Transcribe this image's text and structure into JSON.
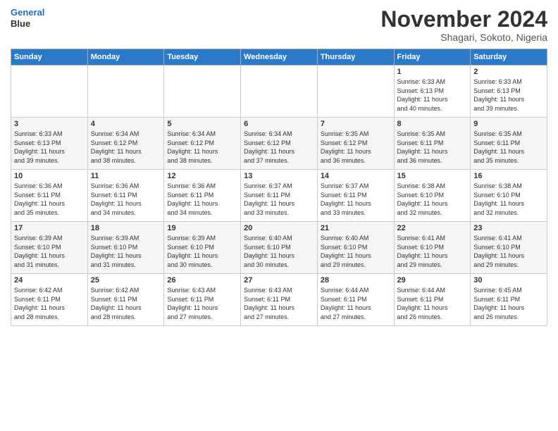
{
  "logo": {
    "line1": "General",
    "line2": "Blue"
  },
  "title": "November 2024",
  "subtitle": "Shagari, Sokoto, Nigeria",
  "days_of_week": [
    "Sunday",
    "Monday",
    "Tuesday",
    "Wednesday",
    "Thursday",
    "Friday",
    "Saturday"
  ],
  "weeks": [
    [
      {
        "day": "",
        "info": ""
      },
      {
        "day": "",
        "info": ""
      },
      {
        "day": "",
        "info": ""
      },
      {
        "day": "",
        "info": ""
      },
      {
        "day": "",
        "info": ""
      },
      {
        "day": "1",
        "info": "Sunrise: 6:33 AM\nSunset: 6:13 PM\nDaylight: 11 hours\nand 40 minutes."
      },
      {
        "day": "2",
        "info": "Sunrise: 6:33 AM\nSunset: 6:13 PM\nDaylight: 11 hours\nand 39 minutes."
      }
    ],
    [
      {
        "day": "3",
        "info": "Sunrise: 6:33 AM\nSunset: 6:13 PM\nDaylight: 11 hours\nand 39 minutes."
      },
      {
        "day": "4",
        "info": "Sunrise: 6:34 AM\nSunset: 6:12 PM\nDaylight: 11 hours\nand 38 minutes."
      },
      {
        "day": "5",
        "info": "Sunrise: 6:34 AM\nSunset: 6:12 PM\nDaylight: 11 hours\nand 38 minutes."
      },
      {
        "day": "6",
        "info": "Sunrise: 6:34 AM\nSunset: 6:12 PM\nDaylight: 11 hours\nand 37 minutes."
      },
      {
        "day": "7",
        "info": "Sunrise: 6:35 AM\nSunset: 6:12 PM\nDaylight: 11 hours\nand 36 minutes."
      },
      {
        "day": "8",
        "info": "Sunrise: 6:35 AM\nSunset: 6:11 PM\nDaylight: 11 hours\nand 36 minutes."
      },
      {
        "day": "9",
        "info": "Sunrise: 6:35 AM\nSunset: 6:11 PM\nDaylight: 11 hours\nand 35 minutes."
      }
    ],
    [
      {
        "day": "10",
        "info": "Sunrise: 6:36 AM\nSunset: 6:11 PM\nDaylight: 11 hours\nand 35 minutes."
      },
      {
        "day": "11",
        "info": "Sunrise: 6:36 AM\nSunset: 6:11 PM\nDaylight: 11 hours\nand 34 minutes."
      },
      {
        "day": "12",
        "info": "Sunrise: 6:36 AM\nSunset: 6:11 PM\nDaylight: 11 hours\nand 34 minutes."
      },
      {
        "day": "13",
        "info": "Sunrise: 6:37 AM\nSunset: 6:11 PM\nDaylight: 11 hours\nand 33 minutes."
      },
      {
        "day": "14",
        "info": "Sunrise: 6:37 AM\nSunset: 6:11 PM\nDaylight: 11 hours\nand 33 minutes."
      },
      {
        "day": "15",
        "info": "Sunrise: 6:38 AM\nSunset: 6:10 PM\nDaylight: 11 hours\nand 32 minutes."
      },
      {
        "day": "16",
        "info": "Sunrise: 6:38 AM\nSunset: 6:10 PM\nDaylight: 11 hours\nand 32 minutes."
      }
    ],
    [
      {
        "day": "17",
        "info": "Sunrise: 6:39 AM\nSunset: 6:10 PM\nDaylight: 11 hours\nand 31 minutes."
      },
      {
        "day": "18",
        "info": "Sunrise: 6:39 AM\nSunset: 6:10 PM\nDaylight: 11 hours\nand 31 minutes."
      },
      {
        "day": "19",
        "info": "Sunrise: 6:39 AM\nSunset: 6:10 PM\nDaylight: 11 hours\nand 30 minutes."
      },
      {
        "day": "20",
        "info": "Sunrise: 6:40 AM\nSunset: 6:10 PM\nDaylight: 11 hours\nand 30 minutes."
      },
      {
        "day": "21",
        "info": "Sunrise: 6:40 AM\nSunset: 6:10 PM\nDaylight: 11 hours\nand 29 minutes."
      },
      {
        "day": "22",
        "info": "Sunrise: 6:41 AM\nSunset: 6:10 PM\nDaylight: 11 hours\nand 29 minutes."
      },
      {
        "day": "23",
        "info": "Sunrise: 6:41 AM\nSunset: 6:10 PM\nDaylight: 11 hours\nand 29 minutes."
      }
    ],
    [
      {
        "day": "24",
        "info": "Sunrise: 6:42 AM\nSunset: 6:11 PM\nDaylight: 11 hours\nand 28 minutes."
      },
      {
        "day": "25",
        "info": "Sunrise: 6:42 AM\nSunset: 6:11 PM\nDaylight: 11 hours\nand 28 minutes."
      },
      {
        "day": "26",
        "info": "Sunrise: 6:43 AM\nSunset: 6:11 PM\nDaylight: 11 hours\nand 27 minutes."
      },
      {
        "day": "27",
        "info": "Sunrise: 6:43 AM\nSunset: 6:11 PM\nDaylight: 11 hours\nand 27 minutes."
      },
      {
        "day": "28",
        "info": "Sunrise: 6:44 AM\nSunset: 6:11 PM\nDaylight: 11 hours\nand 27 minutes."
      },
      {
        "day": "29",
        "info": "Sunrise: 6:44 AM\nSunset: 6:11 PM\nDaylight: 11 hours\nand 26 minutes."
      },
      {
        "day": "30",
        "info": "Sunrise: 6:45 AM\nSunset: 6:11 PM\nDaylight: 11 hours\nand 26 minutes."
      }
    ]
  ]
}
